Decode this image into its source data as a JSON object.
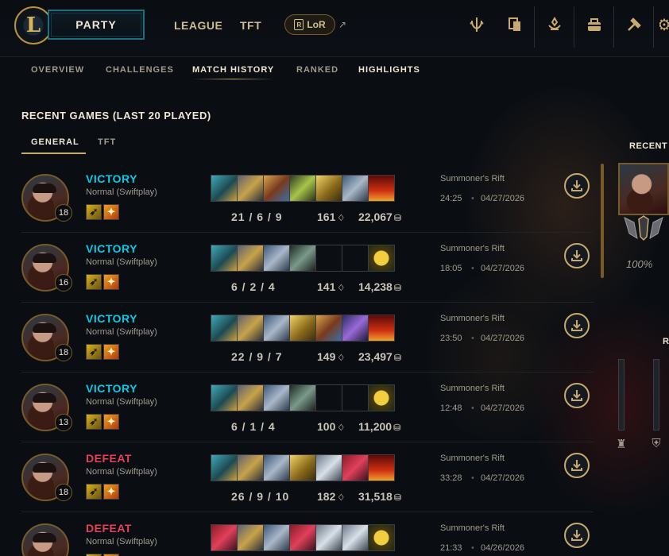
{
  "topnav": {
    "logo": "L",
    "party_label": "PARTY",
    "links": [
      "LEAGUE",
      "TFT"
    ],
    "lor_label": "LoR",
    "lor_mark": "R",
    "external_icon": "external-link-icon",
    "icons": [
      "tft-icon",
      "collection-icon",
      "loot-icon",
      "store-icon",
      "crafting-icon"
    ]
  },
  "subnav": {
    "tabs": [
      "OVERVIEW",
      "CHALLENGES",
      "MATCH HISTORY",
      "RANKED",
      "HIGHLIGHTS"
    ],
    "active": "MATCH HISTORY"
  },
  "recent": {
    "title": "RECENT GAMES (LAST 20 PLAYED)",
    "tabs": [
      "GENERAL",
      "TFT"
    ],
    "active_tab": "GENERAL"
  },
  "games": [
    {
      "result": "VICTORY",
      "outcome": "win",
      "queue": "Normal (Swiftplay)",
      "level": "18",
      "items": [
        "i-gun",
        "i-helm",
        "i-bow",
        "i-spike",
        "i-gold",
        "i-boot",
        "i-ward"
      ],
      "kda": "21 / 6 / 9",
      "cs": "161",
      "gold": "22,067",
      "map": "Summoner's Rift",
      "duration": "24:25",
      "date": "04/27/2026"
    },
    {
      "result": "VICTORY",
      "outcome": "win",
      "queue": "Normal (Swiftplay)",
      "level": "16",
      "items": [
        "i-gun",
        "i-helm",
        "i-boot",
        "i-pick",
        "",
        "",
        "i-yellow"
      ],
      "kda": "6 / 2 / 4",
      "cs": "141",
      "gold": "14,238",
      "map": "Summoner's Rift",
      "duration": "18:05",
      "date": "04/27/2026"
    },
    {
      "result": "VICTORY",
      "outcome": "win",
      "queue": "Normal (Swiftplay)",
      "level": "18",
      "items": [
        "i-gun",
        "i-helm",
        "i-boot",
        "i-gold",
        "i-bow",
        "i-purple",
        "i-ward"
      ],
      "kda": "22 / 9 / 7",
      "cs": "149",
      "gold": "23,497",
      "map": "Summoner's Rift",
      "duration": "23:50",
      "date": "04/27/2026"
    },
    {
      "result": "VICTORY",
      "outcome": "win",
      "queue": "Normal (Swiftplay)",
      "level": "13",
      "items": [
        "i-gun",
        "i-helm",
        "i-boot",
        "i-pick",
        "",
        "",
        "i-yellow"
      ],
      "kda": "6 / 1 / 4",
      "cs": "100",
      "gold": "11,200",
      "map": "Summoner's Rift",
      "duration": "12:48",
      "date": "04/27/2026"
    },
    {
      "result": "DEFEAT",
      "outcome": "loss",
      "queue": "Normal (Swiftplay)",
      "level": "18",
      "items": [
        "i-gun",
        "i-helm",
        "i-boot",
        "i-gold",
        "i-silver",
        "i-red",
        "i-ward"
      ],
      "kda": "26 / 9 / 10",
      "cs": "182",
      "gold": "31,518",
      "map": "Summoner's Rift",
      "duration": "33:28",
      "date": "04/27/2026"
    },
    {
      "result": "DEFEAT",
      "outcome": "loss",
      "queue": "Normal (Swiftplay)",
      "level": "",
      "items": [
        "i-red",
        "i-helm",
        "i-boot",
        "i-red",
        "i-silver",
        "i-silver",
        "i-yellow"
      ],
      "kda": "",
      "cs": "",
      "gold": "",
      "map": "Summoner's Rift",
      "duration": "21:33",
      "date": "04/26/2026"
    }
  ],
  "right_panel": {
    "title": "RECENT",
    "percent": "100%",
    "letter": "R",
    "bars": 2,
    "role_icons": [
      "top-role-icon",
      "jungle-role-icon"
    ]
  },
  "colors": {
    "win": "#0acbe6",
    "loss": "#e84057",
    "gold_accent": "#c8aa6e",
    "background": "#0a0e13"
  }
}
